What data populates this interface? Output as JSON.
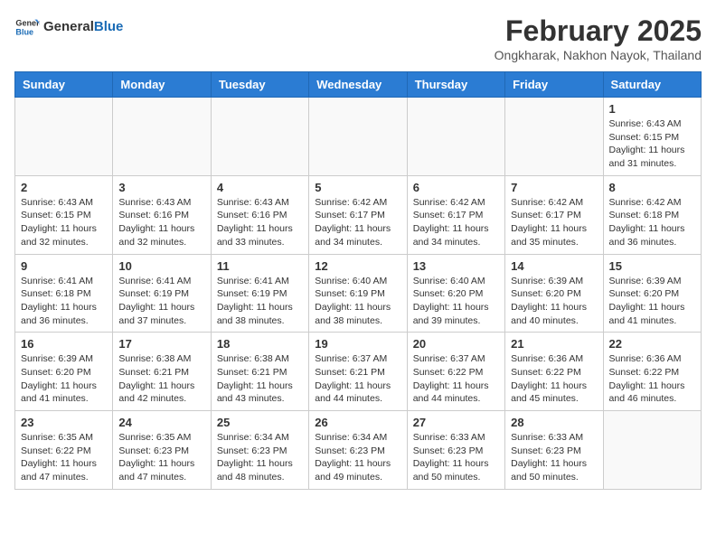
{
  "header": {
    "logo_general": "General",
    "logo_blue": "Blue",
    "month_year": "February 2025",
    "location": "Ongkharak, Nakhon Nayok, Thailand"
  },
  "weekdays": [
    "Sunday",
    "Monday",
    "Tuesday",
    "Wednesday",
    "Thursday",
    "Friday",
    "Saturday"
  ],
  "weeks": [
    [
      {
        "day": "",
        "sunrise": "",
        "sunset": "",
        "daylight": ""
      },
      {
        "day": "",
        "sunrise": "",
        "sunset": "",
        "daylight": ""
      },
      {
        "day": "",
        "sunrise": "",
        "sunset": "",
        "daylight": ""
      },
      {
        "day": "",
        "sunrise": "",
        "sunset": "",
        "daylight": ""
      },
      {
        "day": "",
        "sunrise": "",
        "sunset": "",
        "daylight": ""
      },
      {
        "day": "",
        "sunrise": "",
        "sunset": "",
        "daylight": ""
      },
      {
        "day": "1",
        "sunrise": "Sunrise: 6:43 AM",
        "sunset": "Sunset: 6:15 PM",
        "daylight": "Daylight: 11 hours and 31 minutes."
      }
    ],
    [
      {
        "day": "2",
        "sunrise": "Sunrise: 6:43 AM",
        "sunset": "Sunset: 6:15 PM",
        "daylight": "Daylight: 11 hours and 32 minutes."
      },
      {
        "day": "3",
        "sunrise": "Sunrise: 6:43 AM",
        "sunset": "Sunset: 6:16 PM",
        "daylight": "Daylight: 11 hours and 32 minutes."
      },
      {
        "day": "4",
        "sunrise": "Sunrise: 6:43 AM",
        "sunset": "Sunset: 6:16 PM",
        "daylight": "Daylight: 11 hours and 33 minutes."
      },
      {
        "day": "5",
        "sunrise": "Sunrise: 6:42 AM",
        "sunset": "Sunset: 6:17 PM",
        "daylight": "Daylight: 11 hours and 34 minutes."
      },
      {
        "day": "6",
        "sunrise": "Sunrise: 6:42 AM",
        "sunset": "Sunset: 6:17 PM",
        "daylight": "Daylight: 11 hours and 34 minutes."
      },
      {
        "day": "7",
        "sunrise": "Sunrise: 6:42 AM",
        "sunset": "Sunset: 6:17 PM",
        "daylight": "Daylight: 11 hours and 35 minutes."
      },
      {
        "day": "8",
        "sunrise": "Sunrise: 6:42 AM",
        "sunset": "Sunset: 6:18 PM",
        "daylight": "Daylight: 11 hours and 36 minutes."
      }
    ],
    [
      {
        "day": "9",
        "sunrise": "Sunrise: 6:41 AM",
        "sunset": "Sunset: 6:18 PM",
        "daylight": "Daylight: 11 hours and 36 minutes."
      },
      {
        "day": "10",
        "sunrise": "Sunrise: 6:41 AM",
        "sunset": "Sunset: 6:19 PM",
        "daylight": "Daylight: 11 hours and 37 minutes."
      },
      {
        "day": "11",
        "sunrise": "Sunrise: 6:41 AM",
        "sunset": "Sunset: 6:19 PM",
        "daylight": "Daylight: 11 hours and 38 minutes."
      },
      {
        "day": "12",
        "sunrise": "Sunrise: 6:40 AM",
        "sunset": "Sunset: 6:19 PM",
        "daylight": "Daylight: 11 hours and 38 minutes."
      },
      {
        "day": "13",
        "sunrise": "Sunrise: 6:40 AM",
        "sunset": "Sunset: 6:20 PM",
        "daylight": "Daylight: 11 hours and 39 minutes."
      },
      {
        "day": "14",
        "sunrise": "Sunrise: 6:39 AM",
        "sunset": "Sunset: 6:20 PM",
        "daylight": "Daylight: 11 hours and 40 minutes."
      },
      {
        "day": "15",
        "sunrise": "Sunrise: 6:39 AM",
        "sunset": "Sunset: 6:20 PM",
        "daylight": "Daylight: 11 hours and 41 minutes."
      }
    ],
    [
      {
        "day": "16",
        "sunrise": "Sunrise: 6:39 AM",
        "sunset": "Sunset: 6:20 PM",
        "daylight": "Daylight: 11 hours and 41 minutes."
      },
      {
        "day": "17",
        "sunrise": "Sunrise: 6:38 AM",
        "sunset": "Sunset: 6:21 PM",
        "daylight": "Daylight: 11 hours and 42 minutes."
      },
      {
        "day": "18",
        "sunrise": "Sunrise: 6:38 AM",
        "sunset": "Sunset: 6:21 PM",
        "daylight": "Daylight: 11 hours and 43 minutes."
      },
      {
        "day": "19",
        "sunrise": "Sunrise: 6:37 AM",
        "sunset": "Sunset: 6:21 PM",
        "daylight": "Daylight: 11 hours and 44 minutes."
      },
      {
        "day": "20",
        "sunrise": "Sunrise: 6:37 AM",
        "sunset": "Sunset: 6:22 PM",
        "daylight": "Daylight: 11 hours and 44 minutes."
      },
      {
        "day": "21",
        "sunrise": "Sunrise: 6:36 AM",
        "sunset": "Sunset: 6:22 PM",
        "daylight": "Daylight: 11 hours and 45 minutes."
      },
      {
        "day": "22",
        "sunrise": "Sunrise: 6:36 AM",
        "sunset": "Sunset: 6:22 PM",
        "daylight": "Daylight: 11 hours and 46 minutes."
      }
    ],
    [
      {
        "day": "23",
        "sunrise": "Sunrise: 6:35 AM",
        "sunset": "Sunset: 6:22 PM",
        "daylight": "Daylight: 11 hours and 47 minutes."
      },
      {
        "day": "24",
        "sunrise": "Sunrise: 6:35 AM",
        "sunset": "Sunset: 6:23 PM",
        "daylight": "Daylight: 11 hours and 47 minutes."
      },
      {
        "day": "25",
        "sunrise": "Sunrise: 6:34 AM",
        "sunset": "Sunset: 6:23 PM",
        "daylight": "Daylight: 11 hours and 48 minutes."
      },
      {
        "day": "26",
        "sunrise": "Sunrise: 6:34 AM",
        "sunset": "Sunset: 6:23 PM",
        "daylight": "Daylight: 11 hours and 49 minutes."
      },
      {
        "day": "27",
        "sunrise": "Sunrise: 6:33 AM",
        "sunset": "Sunset: 6:23 PM",
        "daylight": "Daylight: 11 hours and 50 minutes."
      },
      {
        "day": "28",
        "sunrise": "Sunrise: 6:33 AM",
        "sunset": "Sunset: 6:23 PM",
        "daylight": "Daylight: 11 hours and 50 minutes."
      },
      {
        "day": "",
        "sunrise": "",
        "sunset": "",
        "daylight": ""
      }
    ]
  ]
}
